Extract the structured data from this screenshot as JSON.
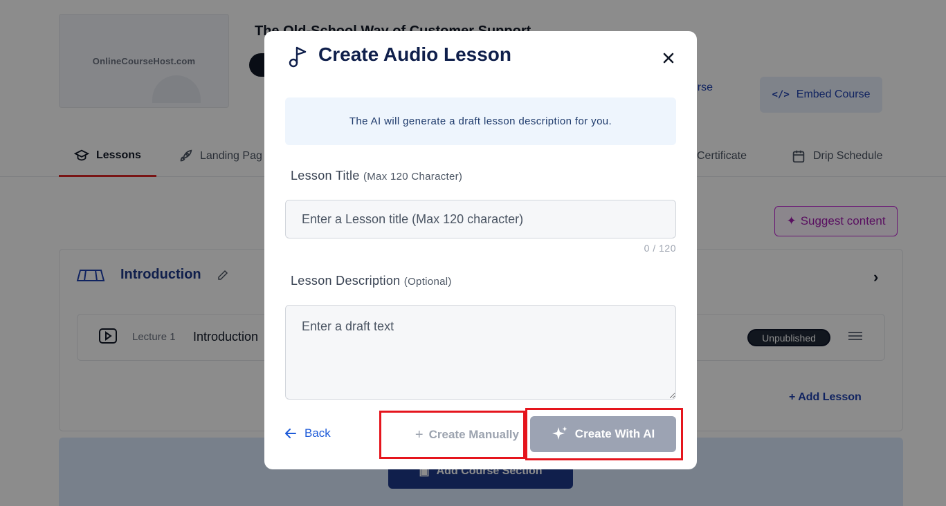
{
  "background": {
    "thumbnail_logo": "OnlineCourseHost.com",
    "course_title": "The Old-School Way of Customer Support",
    "view_course_label": "ourse",
    "embed_course_label": "Embed Course",
    "tabs": [
      {
        "label": "Lessons",
        "icon": "graduation-cap-icon",
        "active": true
      },
      {
        "label": "Landing Pag",
        "icon": "rocket-icon",
        "active": false
      },
      {
        "label": "Certificate",
        "icon": "certificate-icon",
        "active": false
      },
      {
        "label": "Drip Schedule",
        "icon": "calendar-icon",
        "active": false
      }
    ],
    "suggest_content_label": "Suggest content",
    "section": {
      "title": "Introduction",
      "lecture_number": "Lecture 1",
      "lecture_title": "Introduction",
      "status_badge": "Unpublished",
      "add_lesson_label": "Add Lesson"
    },
    "add_course_section_label": "Add Course Section"
  },
  "modal": {
    "title": "Create Audio Lesson",
    "info_text": "The AI will generate a draft lesson description for you.",
    "lesson_title": {
      "label": "Lesson Title",
      "hint": "(Max 120 Character)",
      "placeholder": "Enter a Lesson title (Max 120 character)",
      "value": "",
      "counter": "0 / 120"
    },
    "lesson_description": {
      "label": "Lesson Description",
      "hint": "(Optional)",
      "placeholder": "Enter a draft text",
      "value": ""
    },
    "back_label": "Back",
    "create_manually_label": "Create Manually",
    "create_with_ai_label": "Create With AI"
  },
  "colors": {
    "overlay": "rgba(0,0,0,0.45)",
    "brand_dark": "#0f1f4b",
    "link_blue": "#1e5bd8",
    "highlight_red": "#e5151d",
    "ai_button_disabled": "#9ca3b3",
    "info_box_bg": "#eef5fd"
  }
}
